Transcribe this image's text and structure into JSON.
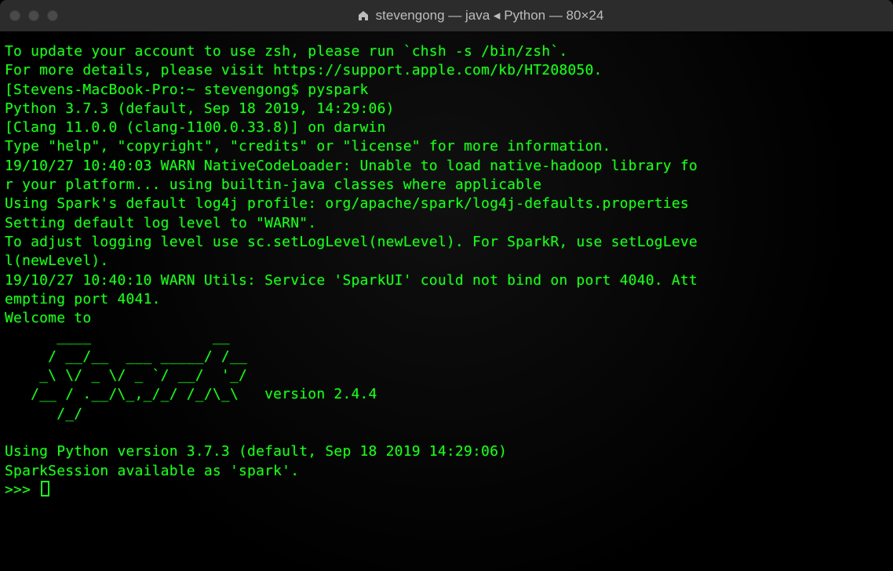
{
  "window": {
    "title": "stevengong — java ◂ Python — 80×24"
  },
  "terminal": {
    "lines": [
      "To update your account to use zsh, please run `chsh -s /bin/zsh`.",
      "For more details, please visit https://support.apple.com/kb/HT208050.",
      "[Stevens-MacBook-Pro:~ stevengong$ pyspark",
      "Python 3.7.3 (default, Sep 18 2019, 14:29:06)",
      "[Clang 11.0.0 (clang-1100.0.33.8)] on darwin",
      "Type \"help\", \"copyright\", \"credits\" or \"license\" for more information.",
      "19/10/27 10:40:03 WARN NativeCodeLoader: Unable to load native-hadoop library fo",
      "r your platform... using builtin-java classes where applicable",
      "Using Spark's default log4j profile: org/apache/spark/log4j-defaults.properties",
      "Setting default log level to \"WARN\".",
      "To adjust logging level use sc.setLogLevel(newLevel). For SparkR, use setLogLeve",
      "l(newLevel).",
      "19/10/27 10:40:10 WARN Utils: Service 'SparkUI' could not bind on port 4040. Att",
      "empting port 4041.",
      "Welcome to",
      "      ____              __",
      "     / __/__  ___ _____/ /__",
      "    _\\ \\/ _ \\/ _ `/ __/  '_/",
      "   /__ / .__/\\_,_/_/ /_/\\_\\   version 2.4.4",
      "      /_/",
      "",
      "Using Python version 3.7.3 (default, Sep 18 2019 14:29:06)",
      "SparkSession available as 'spark'.",
      ">>> "
    ]
  }
}
